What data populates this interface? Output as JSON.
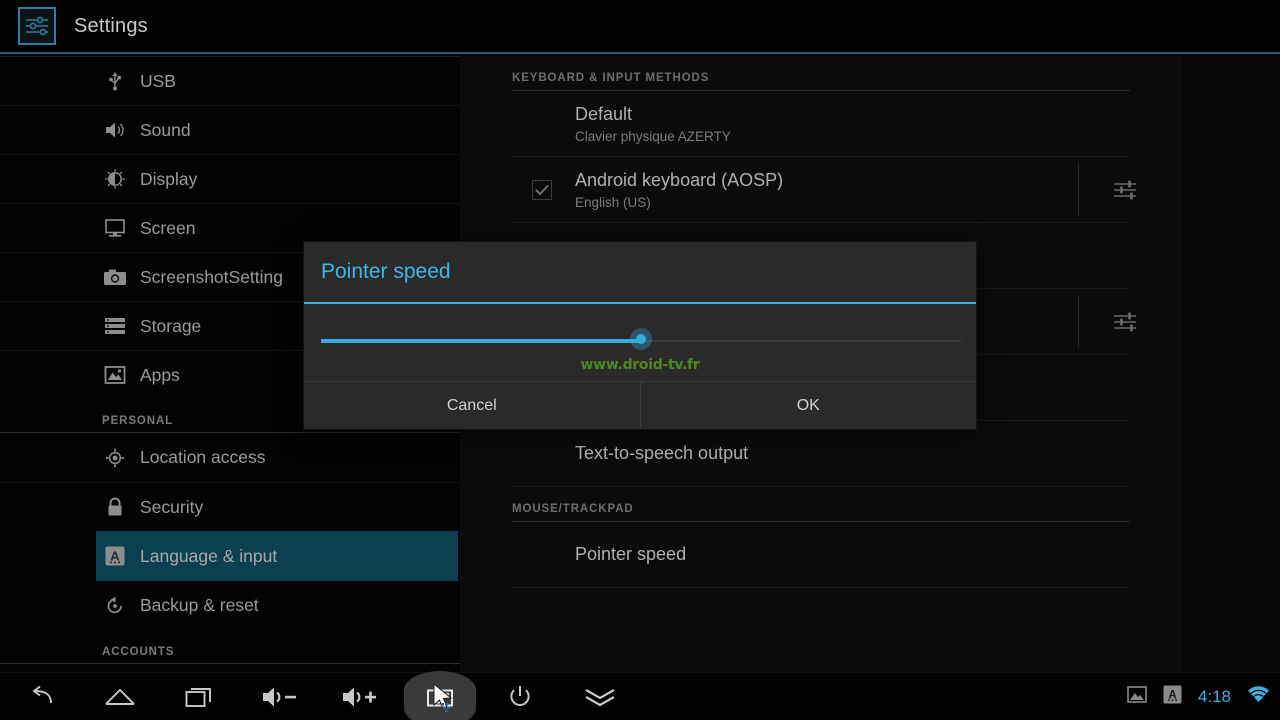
{
  "app": {
    "title": "Settings",
    "icon": "settings-sliders-icon"
  },
  "sidebar": {
    "items": [
      {
        "label": "USB",
        "icon": "usb-icon",
        "selected": false
      },
      {
        "label": "Sound",
        "icon": "sound-speaker-icon",
        "selected": false
      },
      {
        "label": "Display",
        "icon": "display-brightness-icon",
        "selected": false
      },
      {
        "label": "Screen",
        "icon": "screen-monitor-icon",
        "selected": false
      },
      {
        "label": "ScreenshotSetting",
        "icon": "camera-icon",
        "selected": false
      },
      {
        "label": "Storage",
        "icon": "storage-stack-icon",
        "selected": false
      },
      {
        "label": "Apps",
        "icon": "apps-image-icon",
        "selected": false
      }
    ],
    "section_personal": "PERSONAL",
    "personal_items": [
      {
        "label": "Location access",
        "icon": "location-crosshair-icon",
        "selected": false
      },
      {
        "label": "Security",
        "icon": "lock-icon",
        "selected": false
      },
      {
        "label": "Language & input",
        "icon": "language-a-icon",
        "selected": true
      },
      {
        "label": "Backup & reset",
        "icon": "backup-restore-icon",
        "selected": false
      }
    ],
    "section_accounts": "ACCOUNTS"
  },
  "content": {
    "section_keyboard": "KEYBOARD & INPUT METHODS",
    "prefs": [
      {
        "title": "Default",
        "subtitle": "Clavier physique AZERTY",
        "checkbox": null,
        "widget": null
      },
      {
        "title": "Android keyboard (AOSP)",
        "subtitle": "English (US)",
        "checkbox": "checked",
        "widget": "settings-sliders-icon"
      }
    ],
    "tts_output": "Text-to-speech output",
    "section_mouse": "MOUSE/TRACKPAD",
    "pointer_speed": "Pointer speed"
  },
  "dialog": {
    "title": "Pointer speed",
    "cancel_label": "Cancel",
    "ok_label": "OK",
    "slider": {
      "value_percent": 50,
      "min": 0,
      "max": 100
    },
    "watermark": "www.droid-tv.fr"
  },
  "navbar": {
    "buttons": [
      {
        "name": "back-icon",
        "label": "Back"
      },
      {
        "name": "home-icon",
        "label": "Home"
      },
      {
        "name": "recents-icon",
        "label": "Recent apps"
      },
      {
        "name": "volume-down-icon",
        "label": "Volume down"
      },
      {
        "name": "volume-up-icon",
        "label": "Volume up"
      },
      {
        "name": "screenshot-camera-icon",
        "label": "Screenshot"
      },
      {
        "name": "power-icon",
        "label": "Power"
      },
      {
        "name": "hide-chevron-icon",
        "label": "Hide navigation"
      }
    ],
    "status": {
      "image_icon": "image-icon",
      "keyboard_icon": "keyboard-language-icon",
      "clock": "4:18",
      "wifi_icon": "wifi-icon"
    }
  },
  "colors": {
    "accent": "#35ace0",
    "selected_row": "#0a4050",
    "watermark": "#4c8a1c",
    "clock": "#3fb0e0"
  }
}
